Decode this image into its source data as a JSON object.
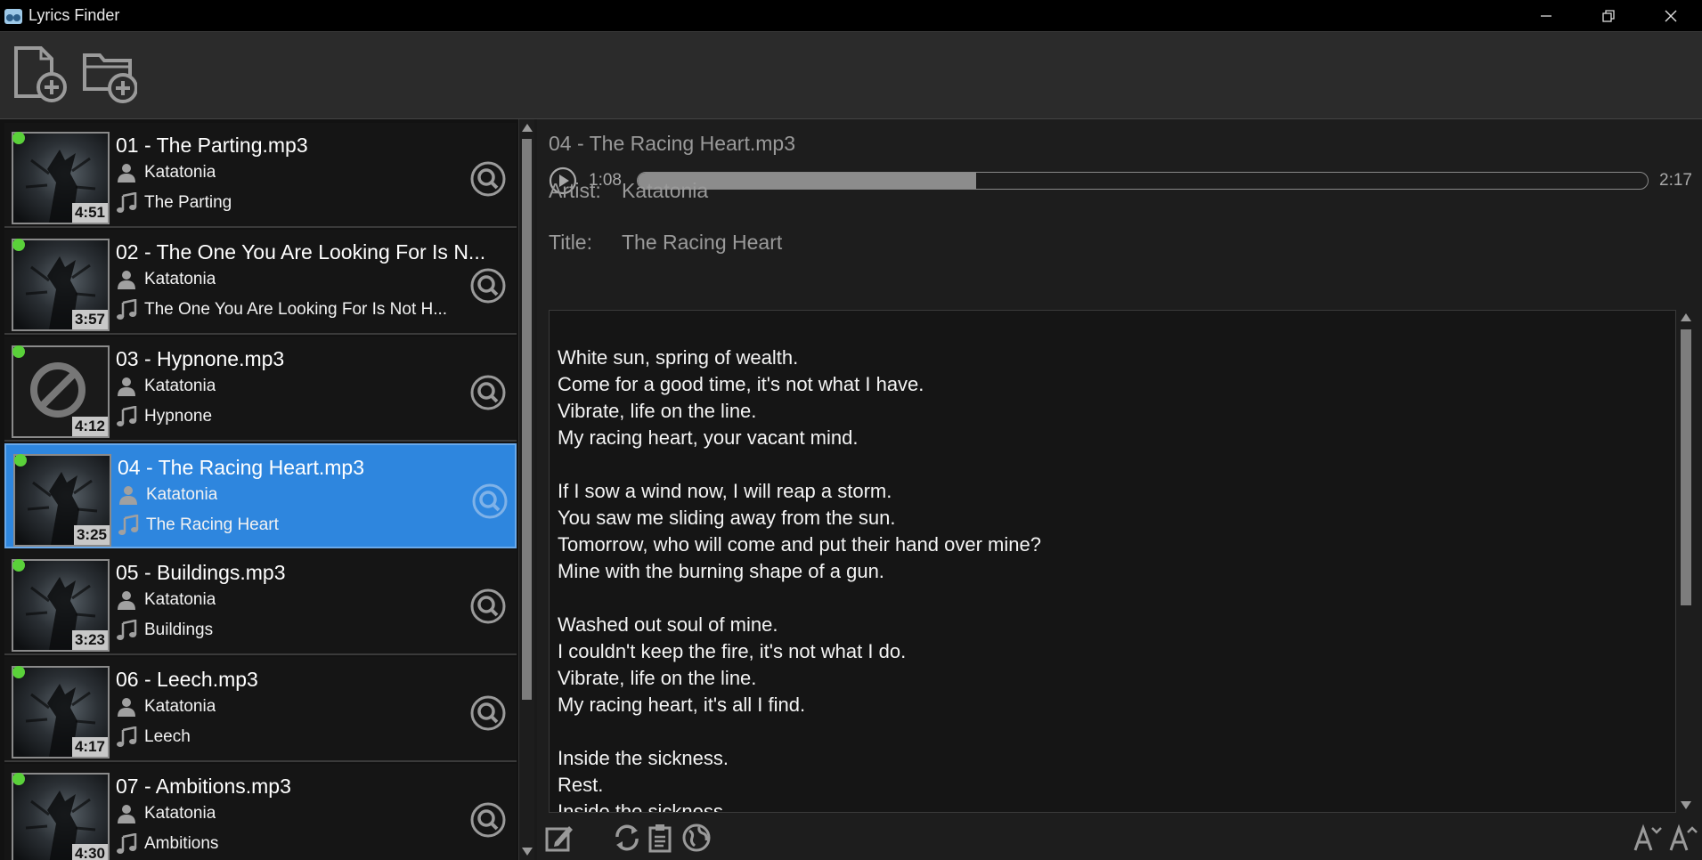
{
  "window": {
    "title": "Lyrics Finder"
  },
  "tracks": [
    {
      "name": "01 - The Parting.mp3",
      "artist": "Katatonia",
      "title": "The Parting",
      "duration": "4:51",
      "has_cover": true,
      "selected": false
    },
    {
      "name": "02 - The One You Are Looking For Is N...",
      "artist": "Katatonia",
      "title": "The One You Are Looking For Is Not H...",
      "duration": "3:57",
      "has_cover": true,
      "selected": false
    },
    {
      "name": "03 - Hypnone.mp3",
      "artist": "Katatonia",
      "title": "Hypnone",
      "duration": "4:12",
      "has_cover": false,
      "selected": false
    },
    {
      "name": "04 - The Racing Heart.mp3",
      "artist": "Katatonia",
      "title": "The Racing Heart",
      "duration": "3:25",
      "has_cover": true,
      "selected": true
    },
    {
      "name": "05 - Buildings.mp3",
      "artist": "Katatonia",
      "title": "Buildings",
      "duration": "3:23",
      "has_cover": true,
      "selected": false
    },
    {
      "name": "06 - Leech.mp3",
      "artist": "Katatonia",
      "title": "Leech",
      "duration": "4:17",
      "has_cover": true,
      "selected": false
    },
    {
      "name": "07 - Ambitions.mp3",
      "artist": "Katatonia",
      "title": "Ambitions",
      "duration": "4:30",
      "has_cover": true,
      "selected": false
    }
  ],
  "detail": {
    "file_name": "04 - The Racing Heart.mp3",
    "time_current": "1:08",
    "time_total": "2:17",
    "progress_fraction": 0.335,
    "artist_label": "Artist:",
    "artist_value": "Katatonia",
    "title_label": "Title:",
    "title_value": "The Racing Heart",
    "lyrics": "White sun, spring of wealth.\nCome for a good time, it's not what I have.\nVibrate, life on the line.\nMy racing heart, your vacant mind.\n\nIf I sow a wind now, I will reap a storm.\nYou saw me sliding away from the sun.\nTomorrow, who will come and put their hand over mine?\nMine with the burning shape of a gun.\n\nWashed out soul of mine.\nI couldn't keep the fire, it's not what I do.\nVibrate, life on the line.\nMy racing heart, it's all I find.\n\nInside the sickness.\nRest.\nInside the sickness."
  },
  "colors": {
    "selected_bg": "#2e86de",
    "status_ok": "#5ad13a"
  },
  "icons": {
    "add_file": "add-file-icon",
    "add_folder": "add-folder-icon",
    "search": "search-icon",
    "play": "play-icon",
    "edit": "edit-icon",
    "refresh": "refresh-icon",
    "clipboard": "clipboard-icon",
    "web": "globe-icon",
    "font_decrease": "font-decrease-icon",
    "font_increase": "font-increase-icon"
  }
}
